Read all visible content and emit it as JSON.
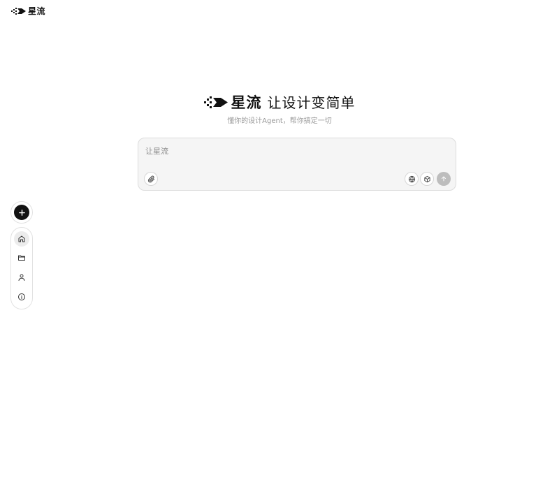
{
  "header": {
    "brand_name": "星流"
  },
  "hero": {
    "brand_name": "星流",
    "slogan": "让设计变简单",
    "subtitle": "懂你的设计Agent，帮你搞定一切"
  },
  "prompt": {
    "placeholder": "让星流",
    "value": "",
    "attach_icon": "paperclip-icon",
    "web_search_icon": "globe-icon",
    "model_icon": "cube-icon",
    "send_icon": "arrow-up-icon",
    "send_enabled": false
  },
  "sidebar": {
    "new_icon": "plus-icon",
    "items": [
      {
        "id": "home",
        "icon": "home-icon",
        "active": true
      },
      {
        "id": "files",
        "icon": "folder-icon",
        "active": false
      },
      {
        "id": "profile",
        "icon": "user-icon",
        "active": false
      },
      {
        "id": "about",
        "icon": "info-icon",
        "active": false
      }
    ]
  },
  "colors": {
    "brand": "#111111",
    "card_bg": "#f5f5f5",
    "send_disabled": "#bdbdbd",
    "subtitle": "#9a9a9a"
  }
}
